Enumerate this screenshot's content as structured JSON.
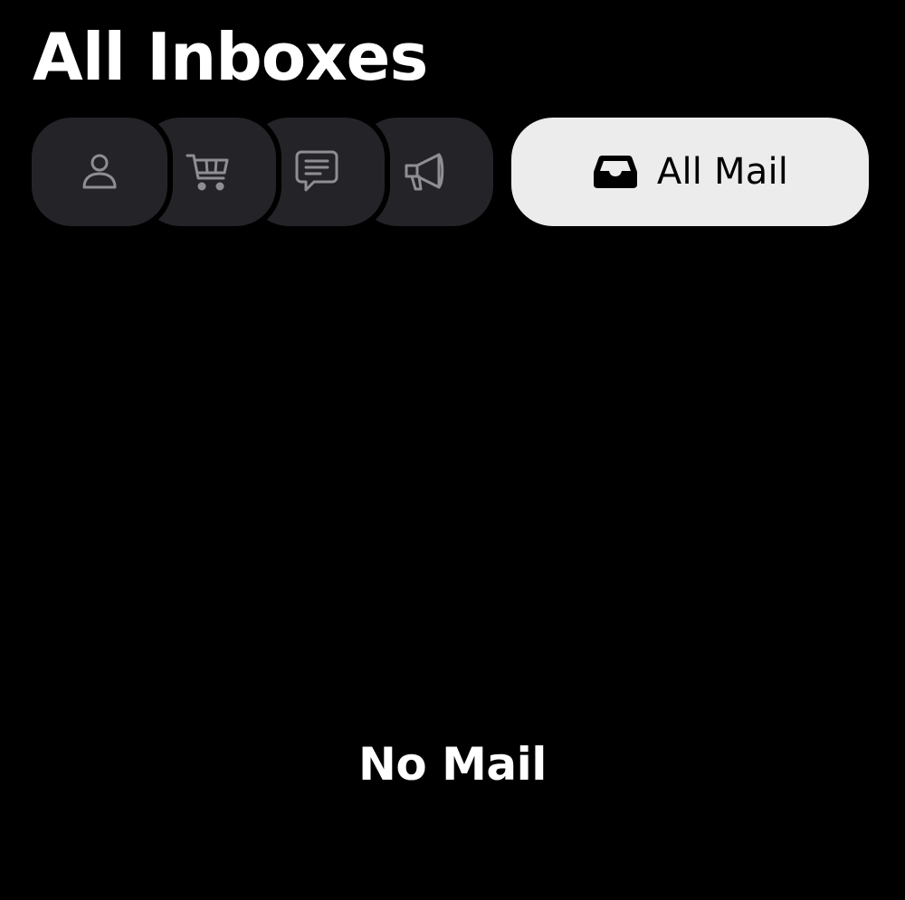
{
  "header": {
    "title": "All Inboxes"
  },
  "categories": {
    "items": [
      {
        "id": "primary",
        "icon": "person-icon"
      },
      {
        "id": "shopping",
        "icon": "cart-icon"
      },
      {
        "id": "transactions",
        "icon": "message-icon"
      },
      {
        "id": "updates",
        "icon": "megaphone-icon"
      }
    ],
    "all_mail": {
      "icon": "tray-icon",
      "label": "All Mail",
      "selected": true
    }
  },
  "main": {
    "empty_message": "No Mail"
  },
  "colors": {
    "background": "#000000",
    "chip_background": "#242428",
    "chip_icon": "#8e8e93",
    "selected_chip_background": "#ececed",
    "selected_chip_foreground": "#000000",
    "text": "#ffffff"
  }
}
